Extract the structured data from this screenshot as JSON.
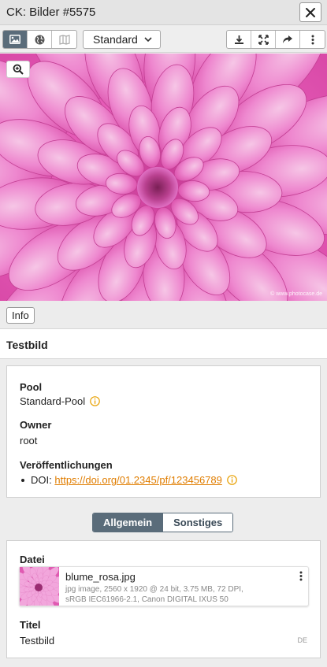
{
  "window": {
    "title": "CK: Bilder #5575",
    "close_icon": "close-icon"
  },
  "toolbar": {
    "view_modes": [
      "image-icon",
      "globe-icon",
      "map-icon"
    ],
    "active_view_mode": "image-icon",
    "view_select": {
      "selected": "Standard"
    },
    "actions": [
      "download-icon",
      "expand-icon",
      "share-icon",
      "more-vertical-icon"
    ]
  },
  "image": {
    "watermark": "© www.photocase.de",
    "zoom_icon": "zoom-in-icon"
  },
  "info_button": "Info",
  "record": {
    "title": "Testbild"
  },
  "details": {
    "pool_label": "Pool",
    "pool_value": "Standard-Pool",
    "owner_label": "Owner",
    "owner_value": "root",
    "publications_label": "Veröffentlichungen",
    "doi_prefix": "DOI:",
    "doi_link": "https://doi.org/01.2345/pf/123456789"
  },
  "tabs": [
    {
      "label": "Allgemein",
      "active": true
    },
    {
      "label": "Sonstiges",
      "active": false
    }
  ],
  "general": {
    "file_label": "Datei",
    "file_name": "blume_rosa.jpg",
    "file_meta_line1": "jpg image,  2560 x 1920 @ 24 bit,  3.75 MB,  72 DPI,",
    "file_meta_line2": "sRGB IEC61966-2.1,  Canon DIGITAL IXUS 50",
    "title_label": "Titel",
    "title_value": "Testbild",
    "language": "DE"
  },
  "colors": {
    "accent": "#5a6c7a",
    "link": "#e07d00",
    "info_icon": "#e8a000",
    "flower": "#e64fb0"
  }
}
